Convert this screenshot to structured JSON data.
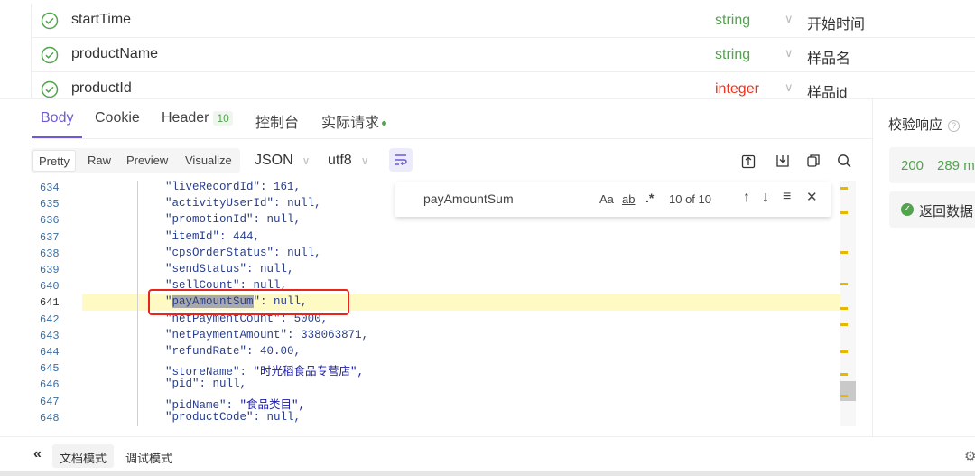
{
  "params": [
    {
      "name": "startTime",
      "type": "string",
      "type_color": "#52a34e",
      "description": "开始时间"
    },
    {
      "name": "productName",
      "type": "string",
      "type_color": "#52a34e",
      "description": "样品名"
    },
    {
      "name": "productId",
      "type": "integer",
      "type_color": "#e8341c",
      "description": "样品id"
    }
  ],
  "tabs": {
    "body": "Body",
    "cookie": "Cookie",
    "header": "Header",
    "header_count": "10",
    "console": "控制台",
    "actual_request": "实际请求"
  },
  "view_modes": [
    "Pretty",
    "Raw",
    "Preview",
    "Visualize"
  ],
  "format_select": "JSON",
  "encoding_select": "utf8",
  "search": {
    "query": "payAmountSum",
    "match_case": "Aa",
    "whole_word": "ab",
    "regex": ".*",
    "count": "10 of 10"
  },
  "code_lines": [
    {
      "n": "634",
      "key": "liveRecordId",
      "value": "161,",
      "kind": "num"
    },
    {
      "n": "635",
      "key": "activityUserId",
      "value": "null,",
      "kind": "null"
    },
    {
      "n": "636",
      "key": "promotionId",
      "value": "null,",
      "kind": "null"
    },
    {
      "n": "637",
      "key": "itemId",
      "value": "444,",
      "kind": "num"
    },
    {
      "n": "638",
      "key": "cpsOrderStatus",
      "value": "null,",
      "kind": "null"
    },
    {
      "n": "639",
      "key": "sendStatus",
      "value": "null,",
      "kind": "null"
    },
    {
      "n": "640",
      "key": "sellCount",
      "value": "null,",
      "kind": "null"
    },
    {
      "n": "641",
      "key": "payAmountSum",
      "value": "null,",
      "kind": "null"
    },
    {
      "n": "642",
      "key": "netPaymentCount",
      "value": "5000,",
      "kind": "num"
    },
    {
      "n": "643",
      "key": "netPaymentAmount",
      "value": "338063871,",
      "kind": "num"
    },
    {
      "n": "644",
      "key": "refundRate",
      "value": "40.00,",
      "kind": "num"
    },
    {
      "n": "645",
      "key": "storeName",
      "value": "\"时光稻食品专营店\",",
      "kind": "str"
    },
    {
      "n": "646",
      "key": "pid",
      "value": "null,",
      "kind": "null"
    },
    {
      "n": "647",
      "key": "pidName",
      "value": "\"食品类目\",",
      "kind": "str"
    },
    {
      "n": "648",
      "key": "productCode",
      "value": "null,",
      "kind": "null"
    }
  ],
  "right_panel": {
    "title": "校验响应",
    "status_code": "200",
    "time": "289 m",
    "return_data": "返回数据"
  },
  "bottom": {
    "collapse": "«",
    "doc_mode": "文档模式",
    "debug_mode": "调试模式"
  },
  "colors": {
    "accent": "#6b5bd6",
    "success": "#52a34e",
    "highlight_row": "#fff9c4",
    "annotation_box": "#e8251b"
  }
}
